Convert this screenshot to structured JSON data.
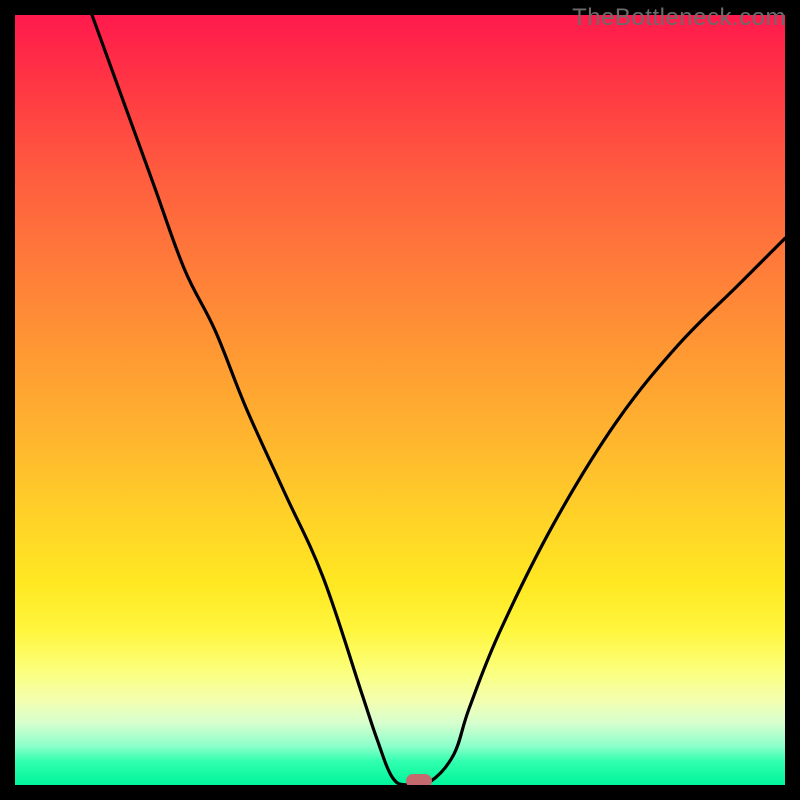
{
  "watermark": "TheBottleneck.com",
  "chart_data": {
    "type": "line",
    "title": "",
    "xlabel": "",
    "ylabel": "",
    "xlim": [
      0,
      100
    ],
    "ylim": [
      0,
      100
    ],
    "grid": false,
    "series": [
      {
        "name": "curve",
        "x": [
          10,
          14,
          18,
          22,
          26,
          30,
          35,
          40,
          45,
          47,
          49,
          51,
          54,
          57,
          59,
          63,
          70,
          78,
          86,
          94,
          100
        ],
        "y": [
          100,
          89,
          78,
          67,
          59,
          49,
          38,
          27,
          12,
          6,
          1,
          0,
          0.5,
          4,
          10,
          20,
          34,
          47,
          57,
          65,
          71
        ]
      }
    ],
    "marker": {
      "x": 52.5,
      "y": 0
    },
    "background_gradient": {
      "direction": "top-to-bottom",
      "stops": [
        {
          "pos": 0.0,
          "color": "#ff1a4d"
        },
        {
          "pos": 0.5,
          "color": "#ffb82e"
        },
        {
          "pos": 0.8,
          "color": "#fff63e"
        },
        {
          "pos": 0.92,
          "color": "#d6ffcf"
        },
        {
          "pos": 1.0,
          "color": "#00f59a"
        }
      ]
    }
  }
}
